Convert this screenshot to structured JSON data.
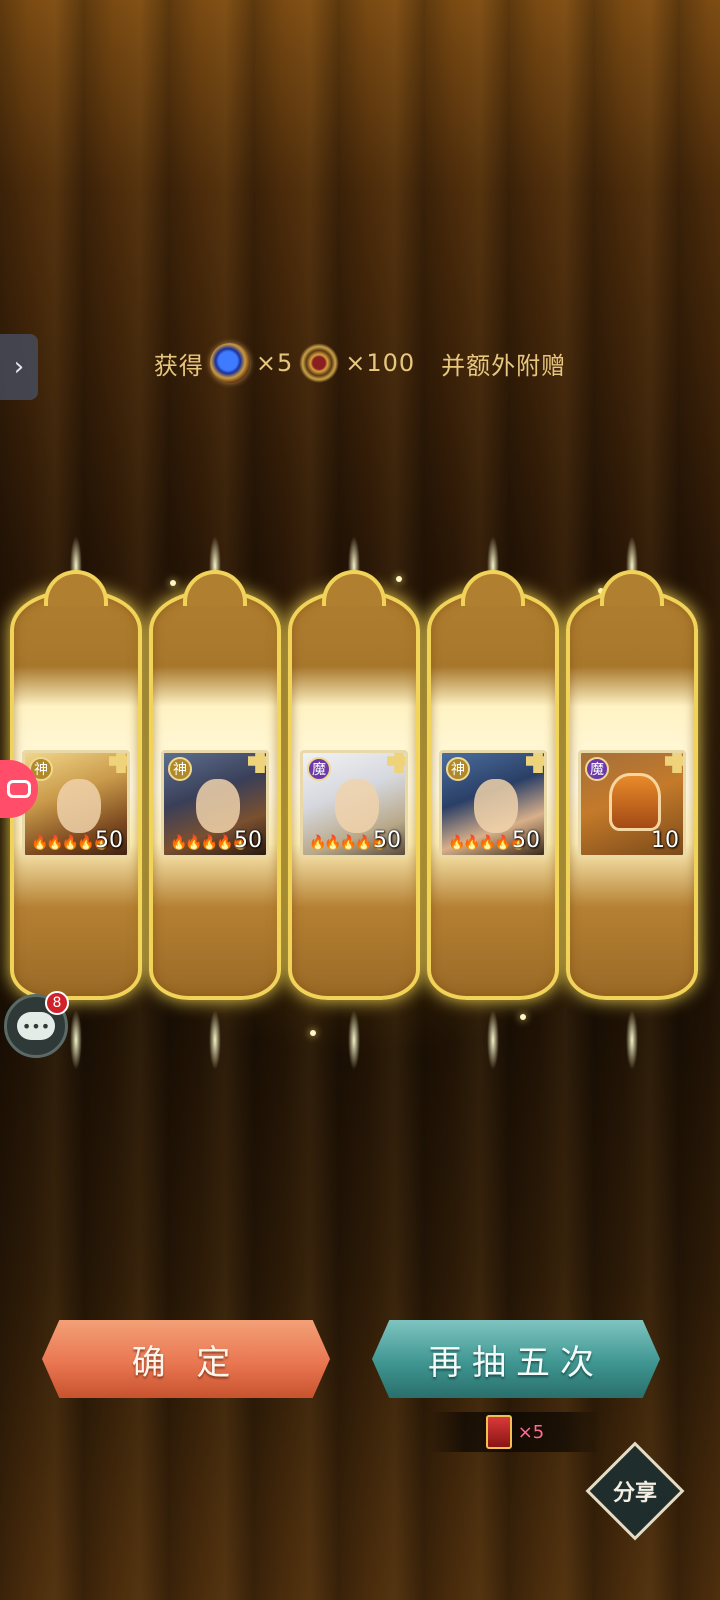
{
  "obtain": {
    "prefix": "获得",
    "item1_qty": "×5",
    "item2_qty": "×100",
    "suffix": "并额外附赠"
  },
  "cards": [
    {
      "faction": "神",
      "level": "50",
      "stars": 5
    },
    {
      "faction": "神",
      "level": "50",
      "stars": 5
    },
    {
      "faction": "魔",
      "level": "50",
      "stars": 5
    },
    {
      "faction": "神",
      "level": "50",
      "stars": 5
    },
    {
      "faction": "魔",
      "level": "10",
      "stars": 0
    }
  ],
  "chat": {
    "badge": "8"
  },
  "buttons": {
    "confirm": "确 定",
    "draw_again": "再抽五次",
    "cost_qty": "×5"
  },
  "share": {
    "label": "分享"
  },
  "icons": {
    "item1": "blue-gem-icon",
    "item2": "gold-ring-icon",
    "side_tab": "chevron-right-icon",
    "chat": "chat-bubble-icon",
    "ticket": "red-ticket-icon"
  },
  "colors": {
    "confirm_button": "#e97752",
    "draw_again_button": "#3f9691",
    "card_border": "#f1d35a",
    "badge": "#d0202a"
  }
}
